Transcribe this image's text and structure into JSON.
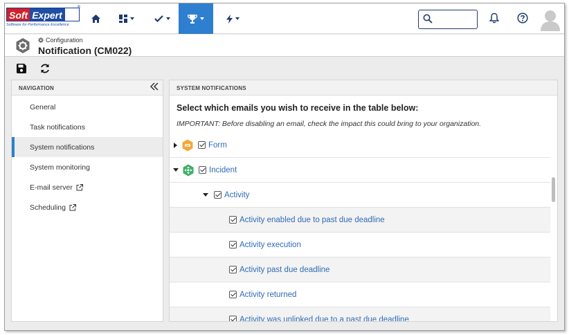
{
  "app": {
    "logo": {
      "soft": "Soft",
      "expert": "Expert",
      "reg": "®",
      "tagline": "Software for Performance Excellence"
    }
  },
  "topnav": {
    "items": [
      {
        "icon": "home-icon",
        "has_caret": false,
        "active": false
      },
      {
        "icon": "dashboard-icon",
        "has_caret": true,
        "active": false
      },
      {
        "icon": "checkmark-icon",
        "has_caret": true,
        "active": false
      },
      {
        "icon": "trophy-icon",
        "has_caret": true,
        "active": true
      },
      {
        "icon": "lightning-icon",
        "has_caret": true,
        "active": false
      }
    ],
    "search_value": "",
    "accent_color": "#2e7fcf"
  },
  "header": {
    "breadcrumb": "Configuration",
    "title": "Notification (CM022)"
  },
  "toolbar": {
    "buttons": [
      {
        "icon": "save-icon"
      },
      {
        "icon": "refresh-icon"
      }
    ]
  },
  "navigation": {
    "heading": "NAVIGATION",
    "items": [
      {
        "label": "General",
        "external": false,
        "active": false
      },
      {
        "label": "Task notifications",
        "external": false,
        "active": false
      },
      {
        "label": "System notifications",
        "external": false,
        "active": true
      },
      {
        "label": "System monitoring",
        "external": false,
        "active": false
      },
      {
        "label": "E-mail server",
        "external": true,
        "active": false
      },
      {
        "label": "Scheduling",
        "external": true,
        "active": false
      }
    ]
  },
  "main": {
    "heading": "SYSTEM NOTIFICATIONS",
    "instruction": "Select which emails you wish to receive in the table below:",
    "important": "IMPORTANT: Before disabling an email, check the impact this could bring to your organization.",
    "tree": [
      {
        "label": "Form",
        "checked": true,
        "expanded": false,
        "level": 0,
        "icon": "form-module-icon"
      },
      {
        "label": "Incident",
        "checked": true,
        "expanded": true,
        "level": 0,
        "icon": "incident-module-icon"
      },
      {
        "label": "Activity",
        "checked": true,
        "expanded": true,
        "level": 1
      },
      {
        "label": "Activity enabled due to past due deadline",
        "checked": true,
        "level": 2
      },
      {
        "label": "Activity execution",
        "checked": true,
        "level": 2
      },
      {
        "label": "Activity past due deadline",
        "checked": true,
        "level": 2
      },
      {
        "label": "Activity returned",
        "checked": true,
        "level": 2
      },
      {
        "label": "Activity was unlinked due to a past due deadline",
        "checked": true,
        "level": 2
      }
    ]
  }
}
